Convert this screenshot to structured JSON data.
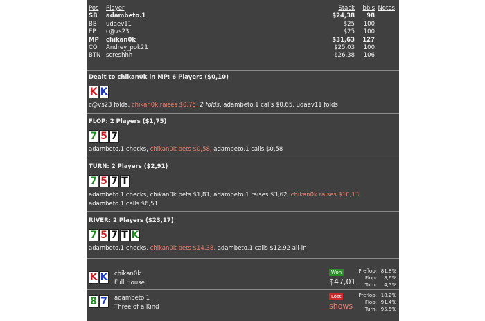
{
  "table": {
    "headers": {
      "pos": "Pos",
      "player": "Player",
      "stack": "Stack",
      "bbs": "bb's",
      "notes": "Notes"
    },
    "rows": [
      {
        "pos": "SB",
        "player": "adambeto.1",
        "stack": "$24,38",
        "bbs": "98",
        "bold": true
      },
      {
        "pos": "BB",
        "player": "udaev11",
        "stack": "$25",
        "bbs": "100",
        "bold": false
      },
      {
        "pos": "EP",
        "player": "c@vs23",
        "stack": "$25",
        "bbs": "100",
        "bold": false
      },
      {
        "pos": "MP",
        "player": "chikan0k",
        "stack": "$31,63",
        "bbs": "127",
        "bold": true
      },
      {
        "pos": "CO",
        "player": "Andrey_pok21",
        "stack": "$25,03",
        "bbs": "100",
        "bold": false
      },
      {
        "pos": "BTN",
        "player": "screshhh",
        "stack": "$26,38",
        "bbs": "106",
        "bold": false
      }
    ]
  },
  "preflop": {
    "heading": "Dealt to chikan0k in MP: 6 Players ($0,10)",
    "cards": [
      {
        "rank": "K",
        "suit": "heart"
      },
      {
        "rank": "K",
        "suit": "diamond"
      }
    ],
    "actions": [
      {
        "text": "c@vs23 folds, ",
        "style": ""
      },
      {
        "text": "chikan0k raises $0,75, ",
        "style": "red"
      },
      {
        "text": "2 folds",
        "style": "it"
      },
      {
        "text": ", adambeto.1 calls $0,65, udaev11 folds",
        "style": ""
      }
    ]
  },
  "flop": {
    "heading": "FLOP: 2 Players ($1,75)",
    "cards": [
      {
        "rank": "7",
        "suit": "club"
      },
      {
        "rank": "5",
        "suit": "heart"
      },
      {
        "rank": "7",
        "suit": "spade"
      }
    ],
    "actions": [
      {
        "text": "adambeto.1 checks, ",
        "style": ""
      },
      {
        "text": "chikan0k bets $0,58, ",
        "style": "red"
      },
      {
        "text": "adambeto.1 calls $0,58",
        "style": ""
      }
    ]
  },
  "turn": {
    "heading": "TURN: 2 Players ($2,91)",
    "cards": [
      {
        "rank": "7",
        "suit": "club"
      },
      {
        "rank": "5",
        "suit": "heart"
      },
      {
        "rank": "7",
        "suit": "spade"
      },
      {
        "rank": "T",
        "suit": "spade"
      }
    ],
    "actions": [
      {
        "text": "adambeto.1 checks, chikan0k bets $1,81, adambeto.1 raises $3,62, ",
        "style": ""
      },
      {
        "text": "chikan0k raises $10,13, ",
        "style": "red"
      },
      {
        "text": "adambeto.1 calls $6,51",
        "style": ""
      }
    ]
  },
  "river": {
    "heading": "RIVER: 2 Players ($23,17)",
    "cards": [
      {
        "rank": "7",
        "suit": "club"
      },
      {
        "rank": "5",
        "suit": "heart"
      },
      {
        "rank": "7",
        "suit": "spade"
      },
      {
        "rank": "T",
        "suit": "spade"
      },
      {
        "rank": "K",
        "suit": "club"
      }
    ],
    "actions": [
      {
        "text": "adambeto.1 checks, ",
        "style": ""
      },
      {
        "text": "chikan0k bets $14,38, ",
        "style": "red"
      },
      {
        "text": "adambeto.1 calls $12,92 all-in",
        "style": ""
      }
    ]
  },
  "results": [
    {
      "cards": [
        {
          "rank": "K",
          "suit": "heart"
        },
        {
          "rank": "K",
          "suit": "diamond"
        }
      ],
      "name": "chikan0k",
      "hand": "Full House",
      "badge": "Won",
      "badge_type": "won",
      "amount": "$47,01",
      "equity": [
        {
          "label": "Preflop:",
          "value": "81,8%"
        },
        {
          "label": "Flop:",
          "value": "8,6%"
        },
        {
          "label": "Turn:",
          "value": "4,5%"
        }
      ]
    },
    {
      "cards": [
        {
          "rank": "8",
          "suit": "club"
        },
        {
          "rank": "7",
          "suit": "diamond"
        }
      ],
      "name": "adambeto.1",
      "hand": "Three of a Kind",
      "badge": "Lost",
      "badge_type": "lost",
      "amount": "shows",
      "equity": [
        {
          "label": "Preflop:",
          "value": "18,2%"
        },
        {
          "label": "Flop:",
          "value": "91,4%"
        },
        {
          "label": "Turn:",
          "value": "95,5%"
        }
      ]
    }
  ],
  "colors": {
    "panel": "#404040",
    "raise_highlight": "#e77f6e",
    "won": "#2a8d2a",
    "lost": "#c92a2a",
    "heart": "#c41e1e",
    "diamond": "#1a3bbf",
    "club": "#1d8a1d",
    "spade": "#111111"
  }
}
